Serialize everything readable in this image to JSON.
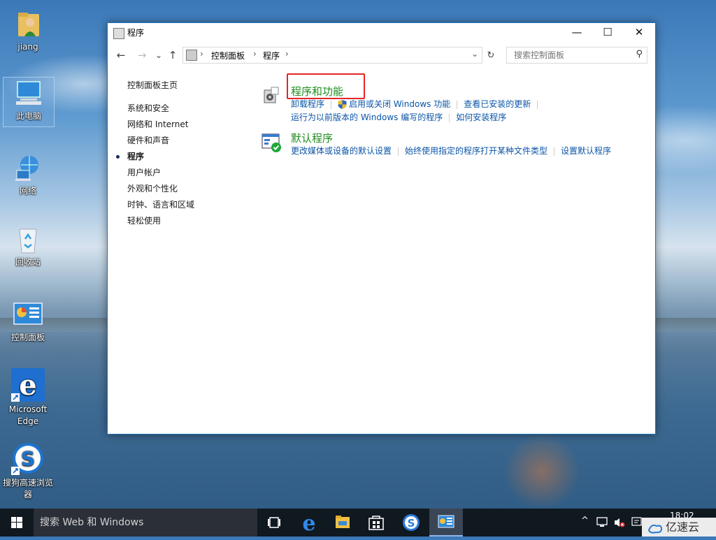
{
  "desktop": {
    "icons": [
      {
        "label": "jiang"
      },
      {
        "label": "此电脑"
      },
      {
        "label": "网络"
      },
      {
        "label": "回收站"
      },
      {
        "label": "控制面板"
      },
      {
        "label": "Microsoft Edge"
      },
      {
        "label": "搜狗高速浏览器"
      }
    ]
  },
  "window": {
    "title": "程序",
    "controls": {
      "minimize": "—",
      "maximize": "☐",
      "close": "✕"
    },
    "address": {
      "back": "←",
      "forward": "→",
      "recent": "⌄",
      "up": "↑",
      "crumbs": [
        "控制面板",
        "程序"
      ],
      "dropdown": "⌄",
      "refresh": "↻",
      "search_placeholder": "搜索控制面板"
    },
    "leftnav": {
      "home": "控制面板主页",
      "items": [
        "系统和安全",
        "网络和 Internet",
        "硬件和声音",
        "程序",
        "用户帐户",
        "外观和个性化",
        "时钟、语言和区域",
        "轻松使用"
      ],
      "current": "程序"
    },
    "categories": [
      {
        "title": "程序和功能",
        "links_row1": [
          "卸载程序",
          "启用或关闭 Windows 功能",
          "查看已安装的更新"
        ],
        "links_row2": [
          "运行为以前版本的 Windows 编写的程序",
          "如何安装程序"
        ]
      },
      {
        "title": "默认程序",
        "links_row1": [
          "更改媒体或设备的默认设置",
          "始终使用指定的程序打开某种文件类型",
          "设置默认程序"
        ]
      }
    ],
    "highlight_color": "#e52626"
  },
  "taskbar": {
    "search_text": "搜索 Web 和 Windows",
    "tray": {
      "chevron": "^",
      "time": "18:02"
    },
    "accent": "#8fb6e6"
  },
  "watermark": {
    "text": "亿速云"
  }
}
